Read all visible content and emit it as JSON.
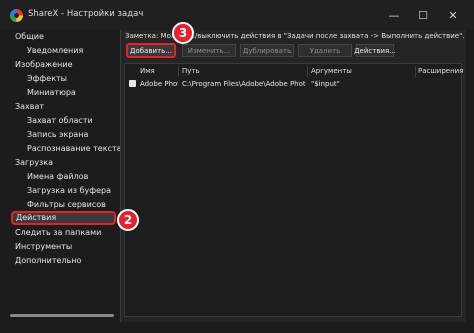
{
  "window": {
    "title": "ShareX - Настройки задач",
    "min": "—",
    "max": "☐",
    "close": "✕"
  },
  "sidebar": {
    "items": [
      {
        "label": "Общие"
      },
      {
        "label": "Уведомления"
      },
      {
        "label": "Изображение"
      },
      {
        "label": "Эффекты"
      },
      {
        "label": "Миниатюра"
      },
      {
        "label": "Захват"
      },
      {
        "label": "Захват области"
      },
      {
        "label": "Запись экрана"
      },
      {
        "label": "Распознавание текста"
      },
      {
        "label": "Загрузка"
      },
      {
        "label": "Имена файлов"
      },
      {
        "label": "Загрузка из буфера"
      },
      {
        "label": "Фильтры сервисов"
      },
      {
        "label": "Действия"
      },
      {
        "label": "Следить за папками"
      },
      {
        "label": "Инструменты"
      },
      {
        "label": "Дополнительно"
      }
    ],
    "selected": "Действия"
  },
  "main": {
    "note": "Заметка: Можно .../выключить действия в \"Задачи после захвата -> Выполнить действие\".",
    "buttons": {
      "add": "Добавить...",
      "edit": "Изменить...",
      "duplicate": "Дублировать",
      "delete": "Удалить",
      "actions": "Действия..."
    },
    "table": {
      "columns": [
        "Имя",
        "Путь",
        "Аргументы",
        "Расширения"
      ],
      "rows": [
        {
          "checked": true,
          "name": "Adobe Phot...",
          "path": "C:\\Program Files\\Adobe\\Adobe Photosho...",
          "args": "\"$input\"",
          "ext": ""
        }
      ]
    }
  },
  "callouts": {
    "c2": "2",
    "c3": "3"
  },
  "colors": {
    "accent": "#e8202a"
  }
}
